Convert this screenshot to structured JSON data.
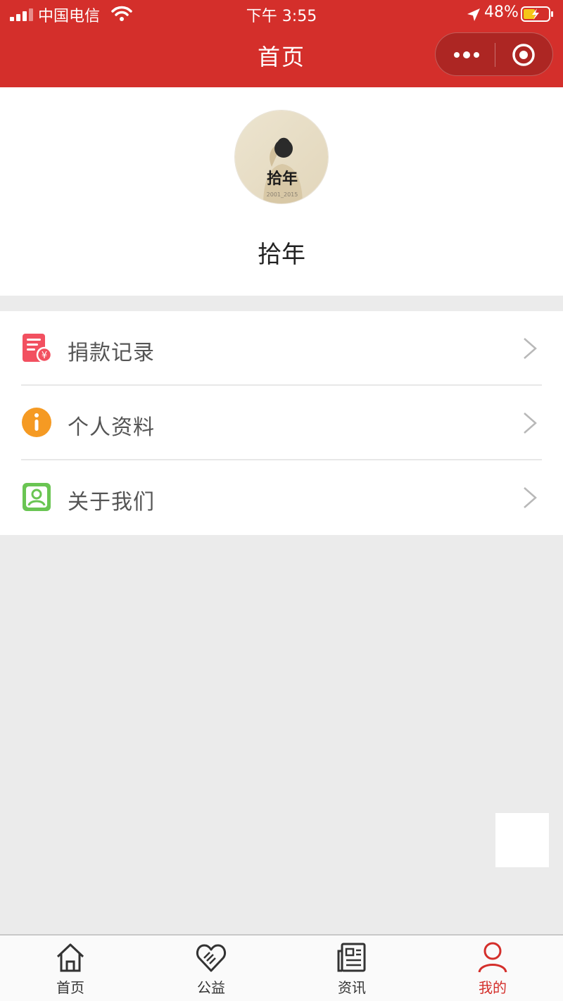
{
  "status_bar": {
    "carrier": "中国电信",
    "time": "下午 3:55",
    "battery": "48%",
    "battery_level": 0.48
  },
  "header": {
    "title": "首页",
    "more_icon": "more-dots-icon",
    "close_icon": "target-circle-icon"
  },
  "profile": {
    "avatar_text": "拾年",
    "avatar_subtext": "2001_2015",
    "name": "拾年"
  },
  "menu": {
    "items": [
      {
        "label": "捐款记录",
        "icon": "donation-record-icon",
        "color": "#f25060"
      },
      {
        "label": "个人资料",
        "icon": "info-icon",
        "color": "#f59a23"
      },
      {
        "label": "关于我们",
        "icon": "contact-card-icon",
        "color": "#6ac553"
      }
    ]
  },
  "tabbar": {
    "tabs": [
      {
        "label": "首页",
        "icon": "home-icon",
        "active": false
      },
      {
        "label": "公益",
        "icon": "heart-hands-icon",
        "active": false
      },
      {
        "label": "资讯",
        "icon": "news-icon",
        "active": false
      },
      {
        "label": "我的",
        "icon": "user-icon",
        "active": true
      }
    ],
    "active_color": "#d42f2b"
  },
  "colors": {
    "brand": "#d42f2b",
    "background": "#ebebeb"
  }
}
